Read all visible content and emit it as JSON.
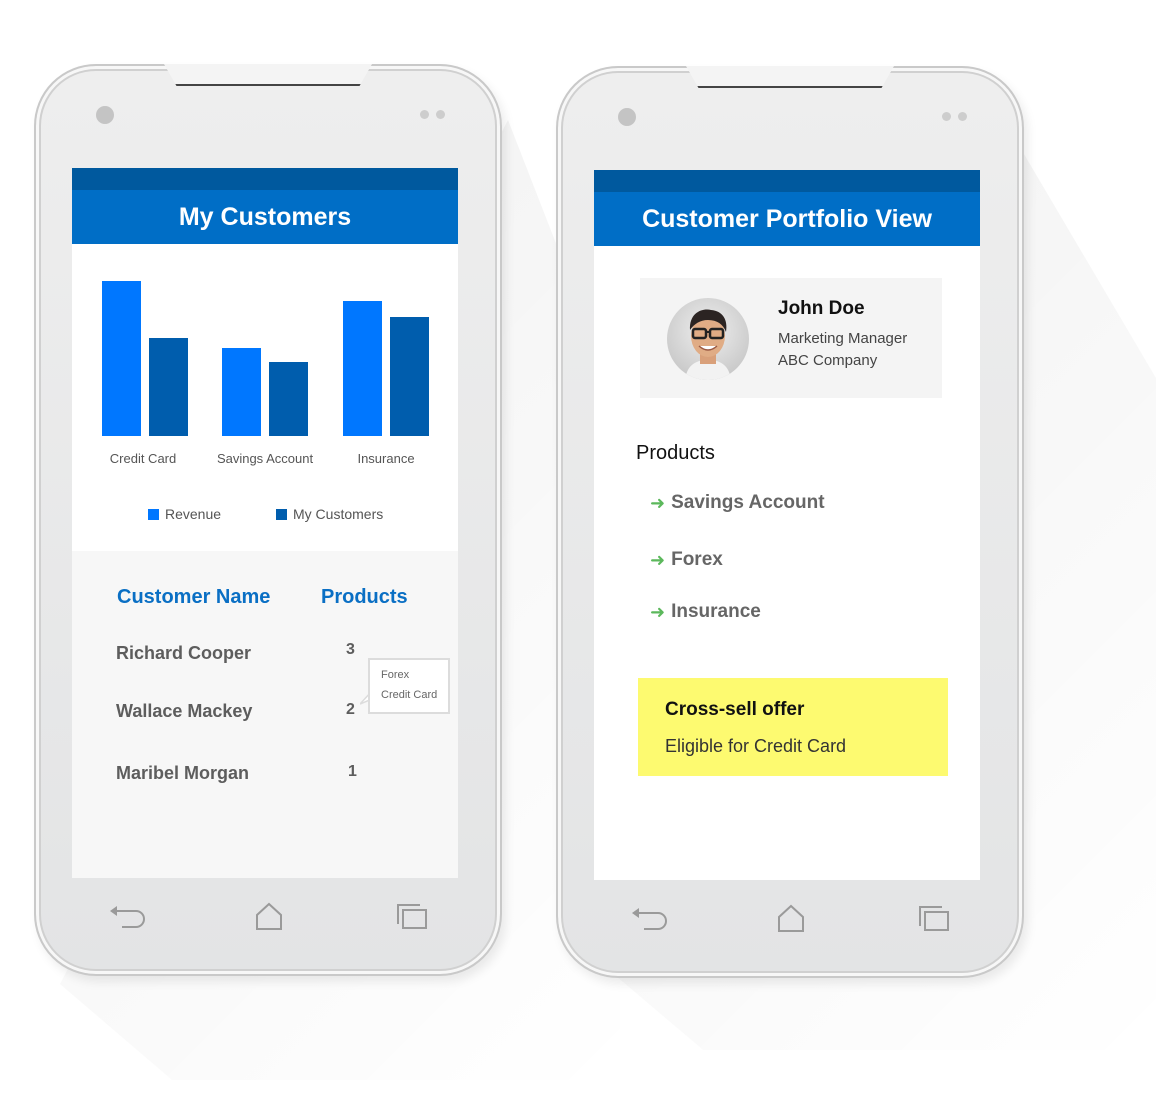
{
  "phones": {
    "left": {
      "title": "My Customers",
      "chart_data": {
        "type": "bar",
        "title": "",
        "xlabel": "",
        "ylabel": "",
        "categories": [
          "Credit Card",
          "Savings Account",
          "Insurance"
        ],
        "series": [
          {
            "name": "Revenue",
            "color": "#0077ff",
            "values": [
              100,
              57,
              87
            ]
          },
          {
            "name": "My Customers",
            "color": "#005dad",
            "values": [
              63,
              48,
              77
            ]
          }
        ],
        "ylim": [
          0,
          100
        ],
        "grid": false,
        "legend": "bottom"
      },
      "table": {
        "headers": [
          "Customer Name",
          "Products"
        ],
        "rows": [
          {
            "name": "Richard Cooper",
            "products": "3"
          },
          {
            "name": "Wallace Mackey",
            "products": "2"
          },
          {
            "name": "Maribel Morgan",
            "products": "1"
          }
        ],
        "tooltip": [
          "Forex",
          "Credit Card"
        ]
      }
    },
    "right": {
      "title": "Customer Portfolio View",
      "profile": {
        "name": "John Doe",
        "role": "Marketing Manager",
        "company": "ABC Company"
      },
      "products_title": "Products",
      "products": [
        "Savings Account",
        "Forex",
        "Insurance"
      ],
      "offer": {
        "title": "Cross-sell offer",
        "text": "Eligible for Credit Card"
      }
    }
  },
  "colors": {
    "header": "#006ec6",
    "status_bar": "#00599e",
    "accent_green": "#5cb85c",
    "offer_bg": "#fdfa70"
  }
}
